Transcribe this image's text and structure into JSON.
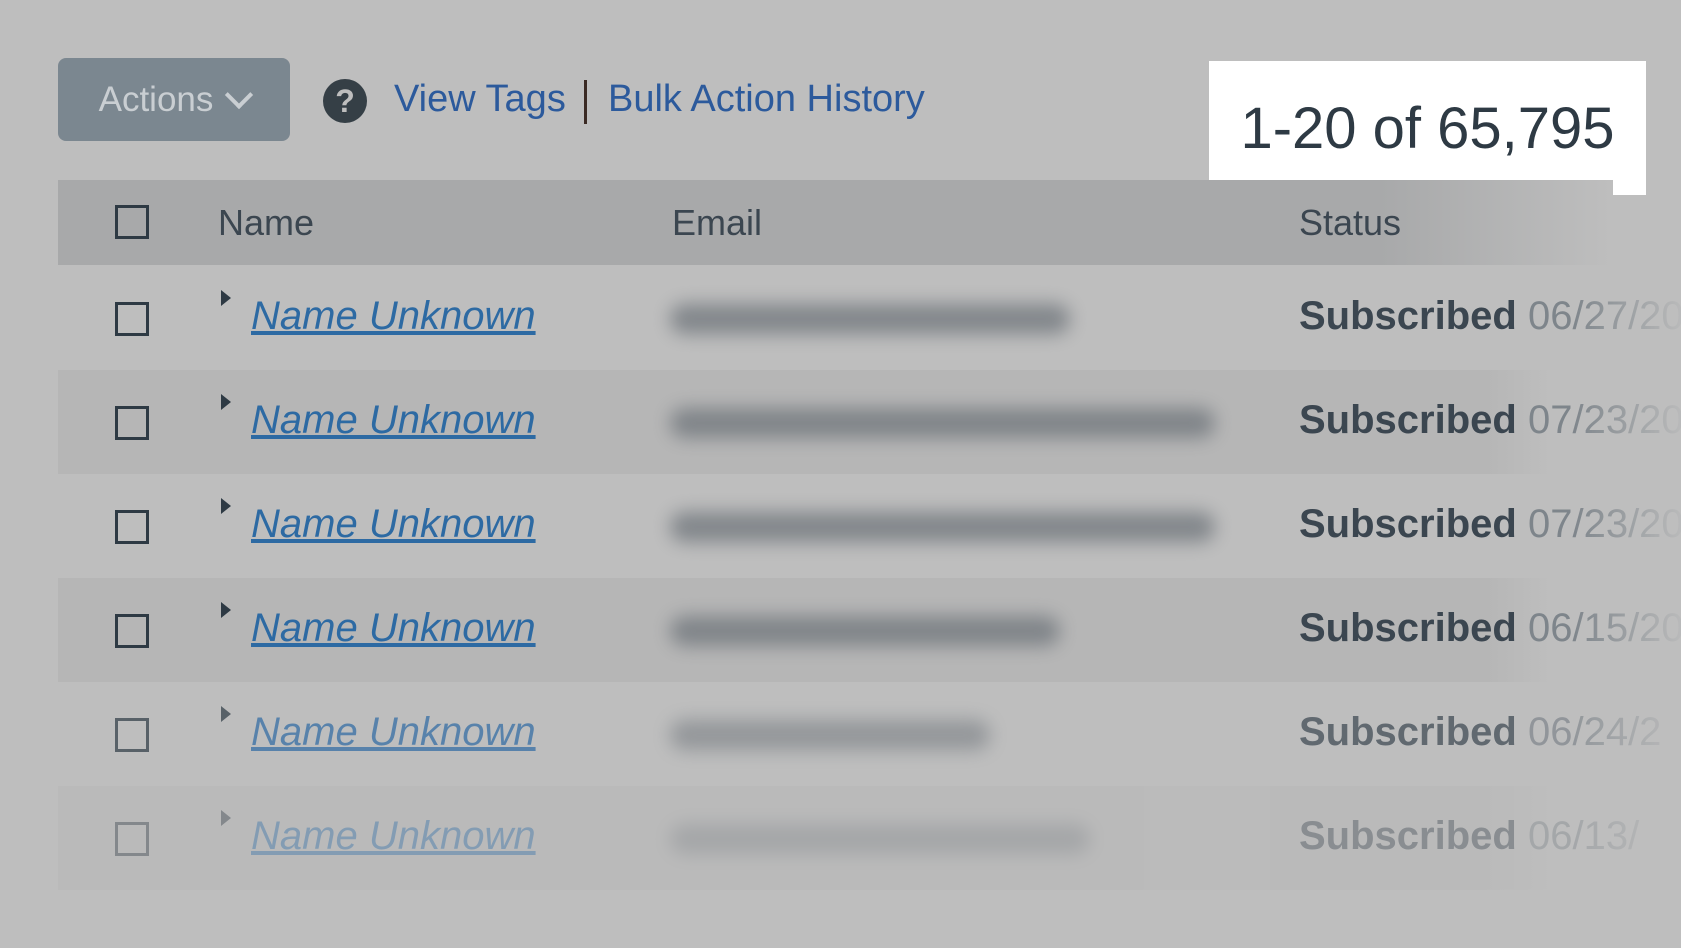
{
  "toolbar": {
    "actions_label": "Actions",
    "help_icon": "question-circle-icon",
    "view_tags": "View Tags",
    "bulk_history": "Bulk Action History"
  },
  "pagination": {
    "range_text": "1-20 of 65,795"
  },
  "table": {
    "columns": [
      "Name",
      "Email",
      "Status"
    ],
    "rows": [
      {
        "name": "Name Unknown",
        "status": "Subscribed",
        "date": "06/27/20"
      },
      {
        "name": "Name Unknown",
        "status": "Subscribed",
        "date": "07/23/20"
      },
      {
        "name": "Name Unknown",
        "status": "Subscribed",
        "date": "07/23/20"
      },
      {
        "name": "Name Unknown",
        "status": "Subscribed",
        "date": "06/15/20"
      },
      {
        "name": "Name Unknown",
        "status": "Subscribed",
        "date": "06/24/2"
      },
      {
        "name": "Name Unknown",
        "status": "Subscribed",
        "date": "06/13/"
      }
    ]
  },
  "colors": {
    "link": "#2d6aa3",
    "actions_button": "#7b8790",
    "header": "#a8a9aa",
    "background": "#bebebe"
  }
}
